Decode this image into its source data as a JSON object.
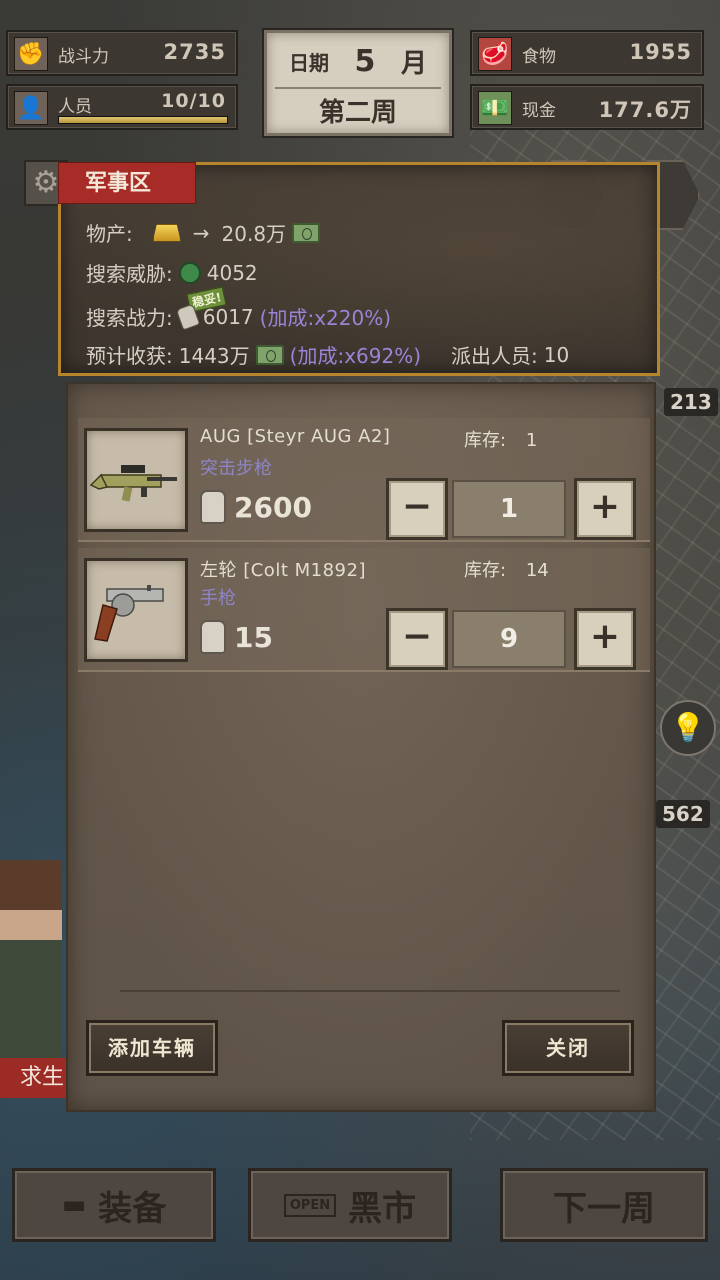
{
  "top_stats": {
    "combat": {
      "label": "战斗力",
      "value": "2735",
      "icon": "fist-icon"
    },
    "staff": {
      "label": "人员",
      "value": "10/10",
      "icon": "person-icon",
      "fill_fraction": 1.0
    },
    "food": {
      "label": "食物",
      "value": "1955",
      "icon": "meat-icon"
    },
    "cash": {
      "label": "现金",
      "value": "177.6万",
      "icon": "cash-icon"
    }
  },
  "date": {
    "label": "日期",
    "month_num": "5",
    "month_unit": "月",
    "week": "第二周"
  },
  "map_tags": {
    "tag1": "213",
    "tag2": "562"
  },
  "side": {
    "survive_label": "求生"
  },
  "modal": {
    "zone": "军事区",
    "resources_label": "物产:",
    "resources_value": "20.8万",
    "threat_label": "搜索威胁:",
    "threat_value": "4052",
    "power_label": "搜索战力:",
    "safe_tag": "稳妥!",
    "power_value": "6017",
    "power_bonus": "(加成:x220%)",
    "harvest_label": "预计收获:",
    "harvest_value": "1443万",
    "harvest_bonus": "(加成:x692%)",
    "dispatch_label": "派出人员:",
    "dispatch_value": "10",
    "items": [
      {
        "name": "AUG [Steyr AUG A2]",
        "type": "突击步枪",
        "stock_label": "库存:",
        "stock": "1",
        "power": "2600",
        "qty": "1"
      },
      {
        "name": "左轮 [Colt M1892]",
        "type": "手枪",
        "stock_label": "库存:",
        "stock": "14",
        "power": "15",
        "qty": "9"
      }
    ],
    "add_vehicle": "添加车辆",
    "close": "关闭"
  },
  "bottom": {
    "equip": "装备",
    "open_sign": "OPEN",
    "market": "黑市",
    "next_week": "下一周"
  }
}
